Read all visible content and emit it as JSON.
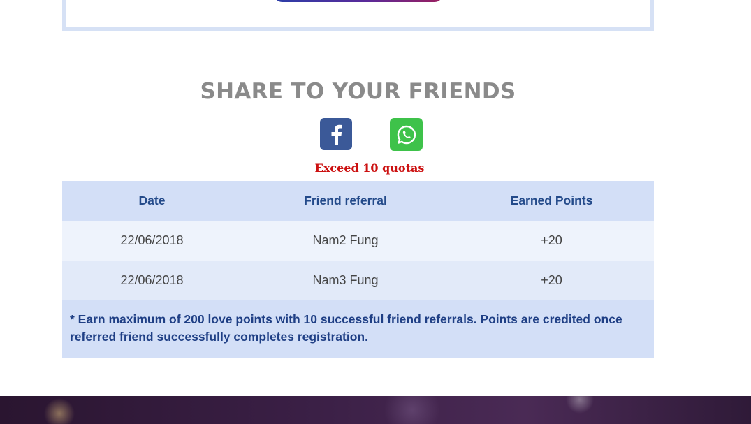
{
  "share": {
    "title": "SHARE TO YOUR FRIENDS",
    "buttons": [
      {
        "name": "facebook",
        "icon": "facebook-icon",
        "color": "#3b5998"
      },
      {
        "name": "whatsapp",
        "icon": "whatsapp-icon",
        "color": "#3ec24a"
      }
    ],
    "quota_note": "Exceed 10 quotas"
  },
  "referrals": {
    "columns": [
      "Date",
      "Friend referral",
      "Earned Points"
    ],
    "rows": [
      {
        "date": "22/06/2018",
        "friend": "Nam2 Fung",
        "points": "+20"
      },
      {
        "date": "22/06/2018",
        "friend": "Nam3 Fung",
        "points": "+20"
      }
    ],
    "footnote": "* Earn maximum of 200 love points with 10 successful friend referrals. Points are credited once referred friend successfully completes registration."
  },
  "colors": {
    "accent": "#234a8a",
    "warning": "#cc1111",
    "table_header_bg": "#d3dff7"
  }
}
